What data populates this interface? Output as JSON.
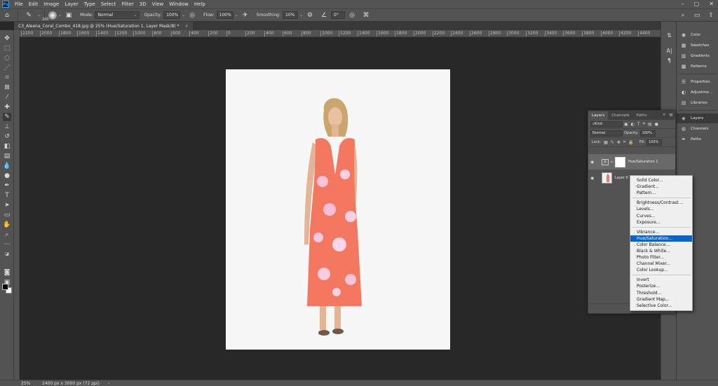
{
  "app": {
    "logo": "Ps"
  },
  "menubar": {
    "items": [
      "File",
      "Edit",
      "Image",
      "Layer",
      "Type",
      "Select",
      "Filter",
      "3D",
      "View",
      "Window",
      "Help"
    ]
  },
  "options": {
    "brush_size": "200",
    "mode_label": "Mode:",
    "mode_value": "Normal",
    "opacity_label": "Opacity:",
    "opacity_value": "100%",
    "flow_label": "Flow:",
    "flow_value": "100%",
    "smoothing_label": "Smoothing:",
    "smoothing_value": "10%",
    "angle_value": "0°"
  },
  "document_tab": {
    "title": "C3_Aleena_Coral_Combo_418.jpg @ 25% (Hue/Saturation 1, Layer Mask/8) *",
    "close": "×"
  },
  "ruler": {
    "ticks": [
      "2200",
      "2000",
      "1800",
      "1600",
      "1400",
      "1200",
      "1000",
      "800",
      "600",
      "400",
      "200",
      "0",
      "200",
      "400",
      "600",
      "800",
      "1000",
      "1200",
      "1400",
      "1600",
      "1800",
      "2000",
      "2200",
      "2400",
      "2600",
      "2800",
      "3000",
      "3200",
      "3400",
      "3600",
      "3800",
      "4000",
      "4200",
      "4400"
    ]
  },
  "status": {
    "zoom": "25%",
    "doc_size": "2400 px x 3000 px (72 ppi)",
    "caret": "›"
  },
  "dock": {
    "items": [
      {
        "label": "Color",
        "icon": "color-wheel-icon"
      },
      {
        "label": "Swatches",
        "icon": "swatches-grid-icon"
      },
      {
        "label": "Gradients",
        "icon": "gradient-icon"
      },
      {
        "label": "Patterns",
        "icon": "patterns-icon"
      },
      {
        "label": "Properties",
        "icon": "properties-sliders-icon"
      },
      {
        "label": "Adjustme...",
        "icon": "adjustments-circle-icon"
      },
      {
        "label": "Libraries",
        "icon": "libraries-icon"
      },
      {
        "label": "Layers",
        "icon": "layers-stack-icon"
      },
      {
        "label": "Channels",
        "icon": "channels-icon"
      },
      {
        "label": "Paths",
        "icon": "paths-pen-icon"
      }
    ]
  },
  "layers_panel": {
    "tabs": [
      "Layers",
      "Channels",
      "Paths"
    ],
    "kind_label": "Kind",
    "blend_mode": "Normal",
    "opacity_label": "Opacity:",
    "opacity_value": "100%",
    "lock_label": "Lock:",
    "fill_label": "Fill:",
    "fill_value": "100%",
    "layers": [
      {
        "name": "Hue/Saturation 1",
        "selected": true
      },
      {
        "name": "Layer 0",
        "selected": false
      }
    ],
    "bottom_icons": [
      "link-icon",
      "fx-icon",
      "mask-icon"
    ]
  },
  "adjustment_menu": {
    "groups": [
      [
        "Solid Color...",
        "Gradient...",
        "Pattern..."
      ],
      [
        "Brightness/Contrast...",
        "Levels...",
        "Curves...",
        "Exposure..."
      ],
      [
        "Vibrance...",
        "Hue/Saturation...",
        "Color Balance...",
        "Black & White...",
        "Photo Filter...",
        "Channel Mixer...",
        "Color Lookup..."
      ],
      [
        "Invert",
        "Posterize...",
        "Threshold...",
        "Gradient Map...",
        "Selective Color..."
      ]
    ],
    "highlighted": "Hue/Saturation..."
  },
  "colors": {
    "ui_panel": "#535353",
    "workspace": "#282828",
    "dress_coral": "#f4775f",
    "menu_highlight": "#0a64c8"
  }
}
